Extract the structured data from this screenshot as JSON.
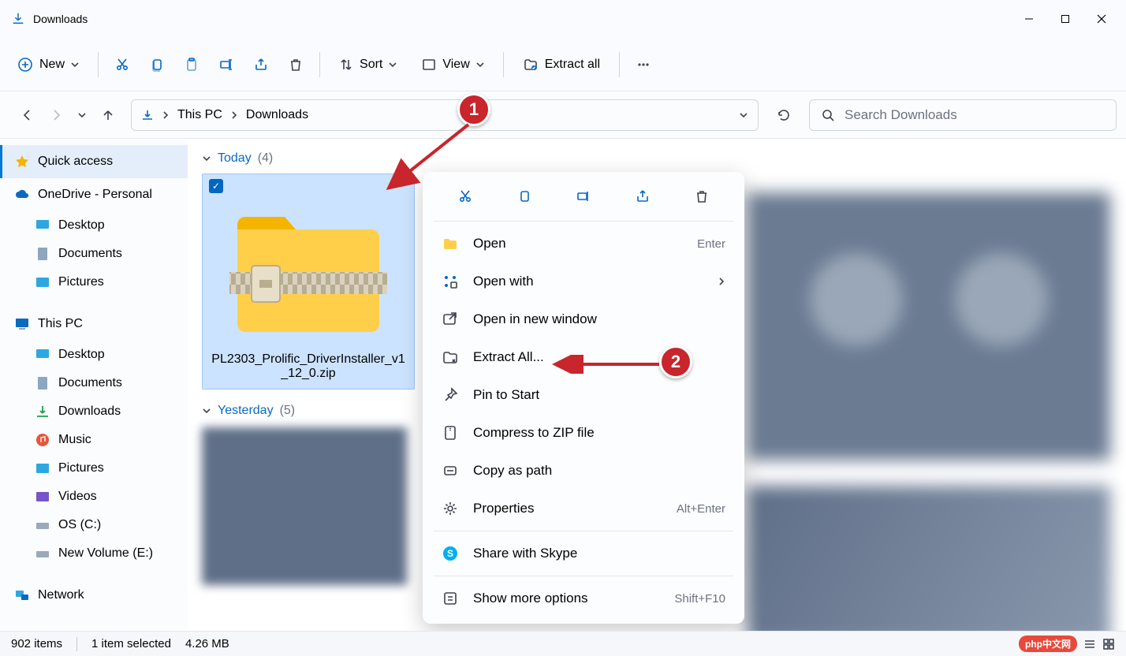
{
  "window": {
    "title": "Downloads"
  },
  "toolbar": {
    "new": "New",
    "sort": "Sort",
    "view": "View",
    "extract_all": "Extract all"
  },
  "breadcrumbs": {
    "pc": "This PC",
    "downloads": "Downloads"
  },
  "search": {
    "placeholder": "Search Downloads"
  },
  "sidebar": {
    "quick_access": "Quick access",
    "onedrive": "OneDrive - Personal",
    "desktop": "Desktop",
    "documents": "Documents",
    "pictures": "Pictures",
    "this_pc": "This PC",
    "desktop2": "Desktop",
    "documents2": "Documents",
    "downloads": "Downloads",
    "music": "Music",
    "pictures2": "Pictures",
    "videos": "Videos",
    "osc": "OS (C:)",
    "newvol": "New Volume (E:)",
    "network": "Network"
  },
  "groups": {
    "today_label": "Today",
    "today_count": "(4)",
    "yesterday_label": "Yesterday",
    "yesterday_count": "(5)"
  },
  "file": {
    "name": "PL2303_Prolific_DriverInstaller_v1_12_0.zip"
  },
  "context_menu": {
    "open": "Open",
    "open_hint": "Enter",
    "open_with": "Open with",
    "open_new_window": "Open in new window",
    "extract_all": "Extract All...",
    "pin_to_start": "Pin to Start",
    "compress": "Compress to ZIP file",
    "copy_path": "Copy as path",
    "properties": "Properties",
    "properties_hint": "Alt+Enter",
    "skype": "Share with Skype",
    "more": "Show more options",
    "more_hint": "Shift+F10"
  },
  "status": {
    "items": "902 items",
    "selected": "1 item selected",
    "size": "4.26 MB"
  },
  "annotations": {
    "one": "1",
    "two": "2"
  },
  "watermark": "php中文网"
}
